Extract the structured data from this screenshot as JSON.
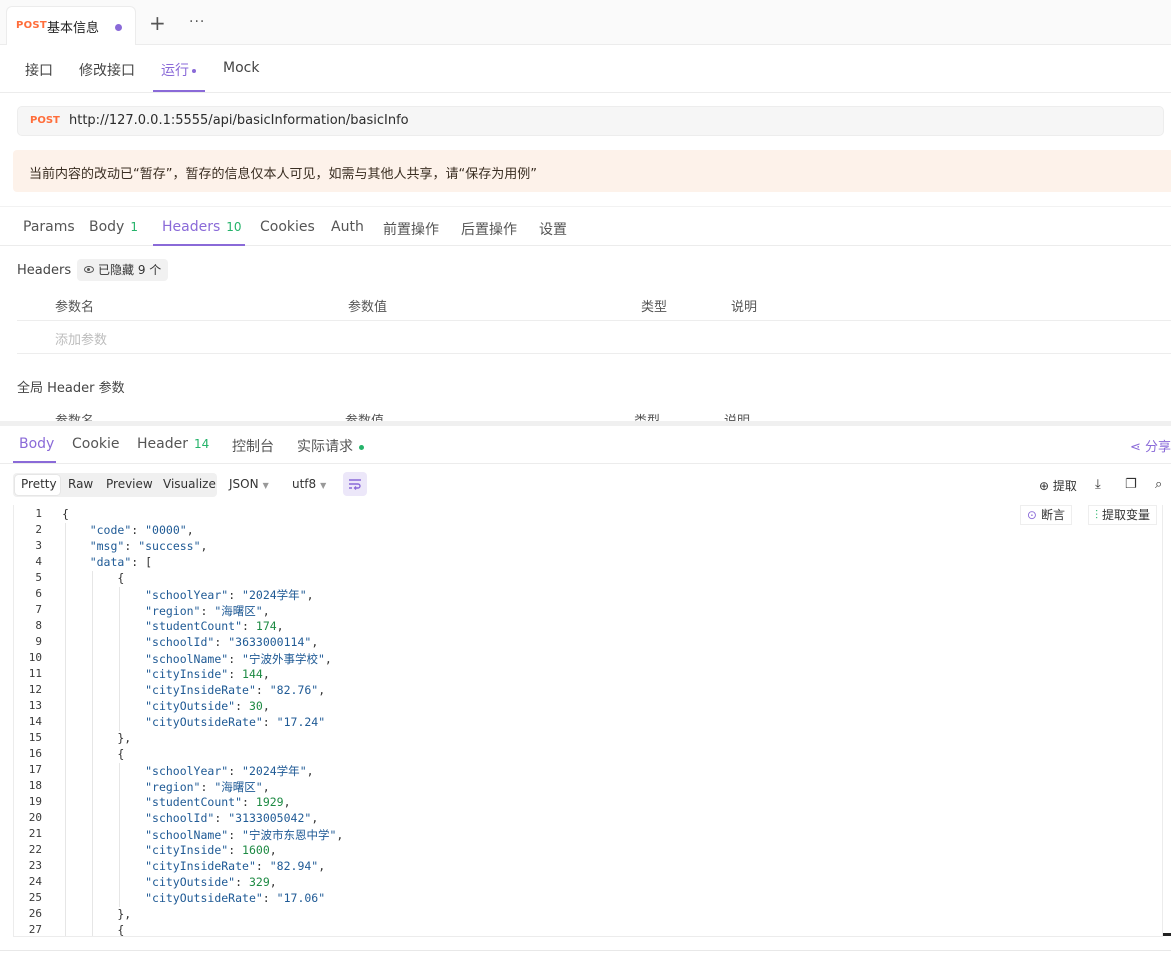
{
  "tab": {
    "method": "POST",
    "name": "基本信息"
  },
  "subnav": [
    "接口",
    "修改接口",
    "运行",
    "Mock"
  ],
  "url": {
    "method": "POST",
    "value": "http://127.0.0.1:5555/api/basicInformation/basicInfo"
  },
  "notice": "当前内容的改动已“暂存”，暂存的信息仅本人可见，如需与其他人共享，请“保存为用例”",
  "request_tabs": {
    "params": "Params",
    "body": "Body",
    "body_count": "1",
    "headers": "Headers",
    "headers_count": "10",
    "cookies": "Cookies",
    "auth": "Auth",
    "pre": "前置操作",
    "post": "后置操作",
    "settings": "设置"
  },
  "headers_section": {
    "label": "Headers",
    "hidden": "已隐藏 9 个",
    "col_name": "参数名",
    "col_value": "参数值",
    "col_type": "类型",
    "col_desc": "说明",
    "add_param": "添加参数",
    "global_label": "全局 Header 参数",
    "g_col_name": "参数名",
    "g_col_value": "参数值",
    "g_col_type": "类型",
    "g_col_desc": "说明"
  },
  "response_tabs": {
    "body": "Body",
    "cookie": "Cookie",
    "header": "Header",
    "header_count": "14",
    "console": "控制台",
    "actual": "实际请求",
    "share": "分享"
  },
  "format": {
    "options": [
      "Pretty",
      "Raw",
      "Preview",
      "Visualize"
    ],
    "lang": "JSON",
    "encoding": "utf8",
    "extract": "提取"
  },
  "code_actions": {
    "assert": "断言",
    "extract_var": "提取变量"
  },
  "code_lines": [
    "1",
    "2",
    "3",
    "4",
    "5",
    "6",
    "7",
    "8",
    "9",
    "10",
    "11",
    "12",
    "13",
    "14",
    "15",
    "16",
    "17",
    "18",
    "19",
    "20",
    "21",
    "22",
    "23",
    "24",
    "25",
    "26",
    "27"
  ],
  "response": {
    "code": "0000",
    "msg": "success",
    "data": [
      {
        "schoolYear": "2024学年",
        "region": "海曙区",
        "studentCount": "174",
        "schoolId": "3633000114",
        "schoolName": "宁波外事学校",
        "cityInside": "144",
        "cityInsideRate": "82.76",
        "cityOutside": "30",
        "cityOutsideRate": "17.24"
      },
      {
        "schoolYear": "2024学年",
        "region": "海曙区",
        "studentCount": "1929",
        "schoolId": "3133005042",
        "schoolName": "宁波市东恩中学",
        "cityInside": "1600",
        "cityInsideRate": "82.94",
        "cityOutside": "329",
        "cityOutsideRate": "17.06"
      }
    ]
  },
  "colors": {
    "accent": "#8a6ad8",
    "method": "#ff6d3a",
    "count": "#25b36a",
    "notice_bg": "#fdf2ea"
  }
}
